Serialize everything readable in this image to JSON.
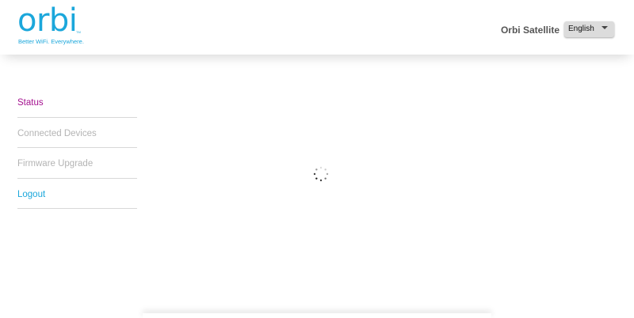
{
  "header": {
    "logo": {
      "wordmark": "orbi",
      "trademark": "TM",
      "tagline": "Better WiFi. Everywhere."
    },
    "device_name": "Orbi Satellite",
    "language": {
      "selected": "English"
    }
  },
  "sidebar": {
    "items": [
      {
        "label": "Status",
        "state": "active"
      },
      {
        "label": "Connected Devices",
        "state": "disabled"
      },
      {
        "label": "Firmware Upgrade",
        "state": "disabled"
      },
      {
        "label": "Logout",
        "state": "link"
      }
    ]
  },
  "main": {
    "loading_icon": "spinner-icon"
  },
  "colors": {
    "brand": "#1ba7db",
    "active": "#a4118f",
    "disabled": "#b4b4b4",
    "text": "#555555"
  }
}
